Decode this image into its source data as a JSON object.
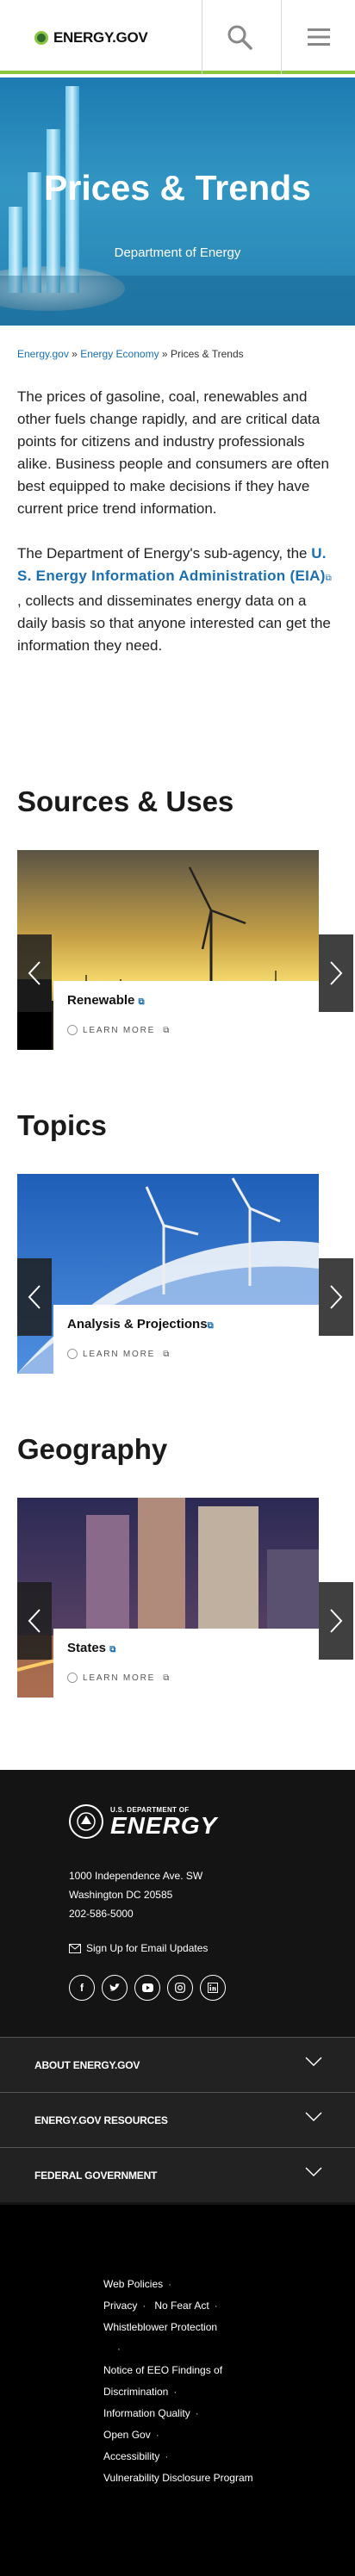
{
  "header": {
    "logo_text": "ENERGY.GOV",
    "search_icon": "search-icon",
    "menu_icon": "hamburger-menu-icon"
  },
  "hero": {
    "title": "Prices & Trends",
    "subtitle": "Department of Energy"
  },
  "breadcrumb": {
    "items": [
      "Energy.gov",
      "Energy Economy",
      "Prices & Trends"
    ],
    "separator": "»"
  },
  "intro": {
    "p1": "The prices of gasoline, coal, renewables and other fuels change rapidly, and are critical data points for citizens and industry professionals alike.  Business people and consumers are often best equipped to make decisions if they have current price trend information.",
    "p2_before": "The Department of Energy's sub-agency, the ",
    "p2_link": "U. S. Energy Information Administration (EIA)",
    "p2_after": " , collects and disseminates energy data on a daily basis so that anyone interested can get the information they need."
  },
  "sections": [
    {
      "title": "Sources & Uses",
      "card_label": "Renewable",
      "learn_more": "LEARN MORE"
    },
    {
      "title": "Topics",
      "card_label": "Analysis & Projections",
      "learn_more": "LEARN MORE"
    },
    {
      "title": "Geography",
      "card_label": "States",
      "learn_more": "LEARN MORE"
    }
  ],
  "footer": {
    "doe_small": "U.S. DEPARTMENT OF",
    "doe_big": "ENERGY",
    "address_line1": "1000 Independence Ave. SW",
    "address_line2": "Washington DC 20585",
    "phone": "202-586-5000",
    "email_signup": "Sign Up for Email Updates",
    "socials": [
      "facebook-icon",
      "twitter-icon",
      "youtube-icon",
      "instagram-icon",
      "linkedin-icon"
    ],
    "accordions": [
      "ABOUT ENERGY.GOV",
      "ENERGY.GOV RESOURCES",
      "FEDERAL GOVERNMENT"
    ],
    "legal_links": [
      "Web Policies",
      "Privacy",
      "No Fear Act",
      "Whistleblower Protection",
      "Notice of EEO Findings of Discrimination",
      "Information Quality",
      "Open Gov",
      "Accessibility",
      "Vulnerability Disclosure Program"
    ]
  },
  "colors": {
    "accent_green": "#8cc63f",
    "link_blue": "#1a6fb0",
    "footer_bg": "#141414"
  }
}
